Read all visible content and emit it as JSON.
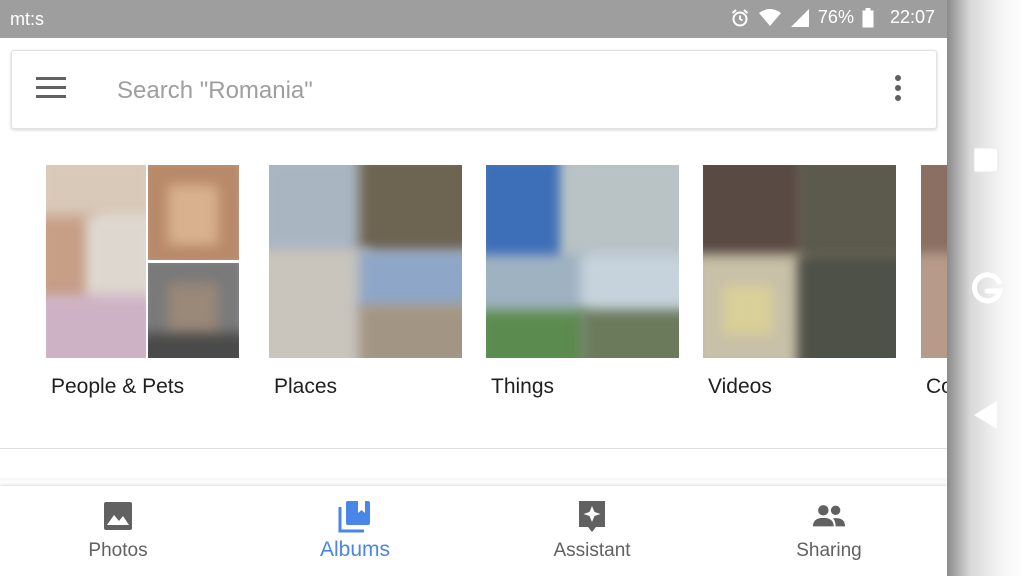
{
  "status_bar": {
    "carrier": "mt:s",
    "battery": "76%",
    "time": "22:07",
    "icons": [
      "alarm-icon",
      "wifi-icon",
      "signal-icon",
      "battery-icon"
    ]
  },
  "search": {
    "placeholder": "Search \"Romania\"",
    "value": ""
  },
  "albums": [
    {
      "label": "People & Pets"
    },
    {
      "label": "Places"
    },
    {
      "label": "Things"
    },
    {
      "label": "Videos"
    },
    {
      "label": "Co"
    }
  ],
  "bottom_nav": {
    "items": [
      {
        "label": "Photos",
        "icon": "photos-icon"
      },
      {
        "label": "Albums",
        "icon": "albums-icon",
        "active": true
      },
      {
        "label": "Assistant",
        "icon": "assistant-icon"
      },
      {
        "label": "Sharing",
        "icon": "sharing-icon"
      }
    ]
  },
  "colors": {
    "accent": "#4a86e8",
    "status_bar": "#9e9e9e",
    "icon_gray": "#616161"
  }
}
